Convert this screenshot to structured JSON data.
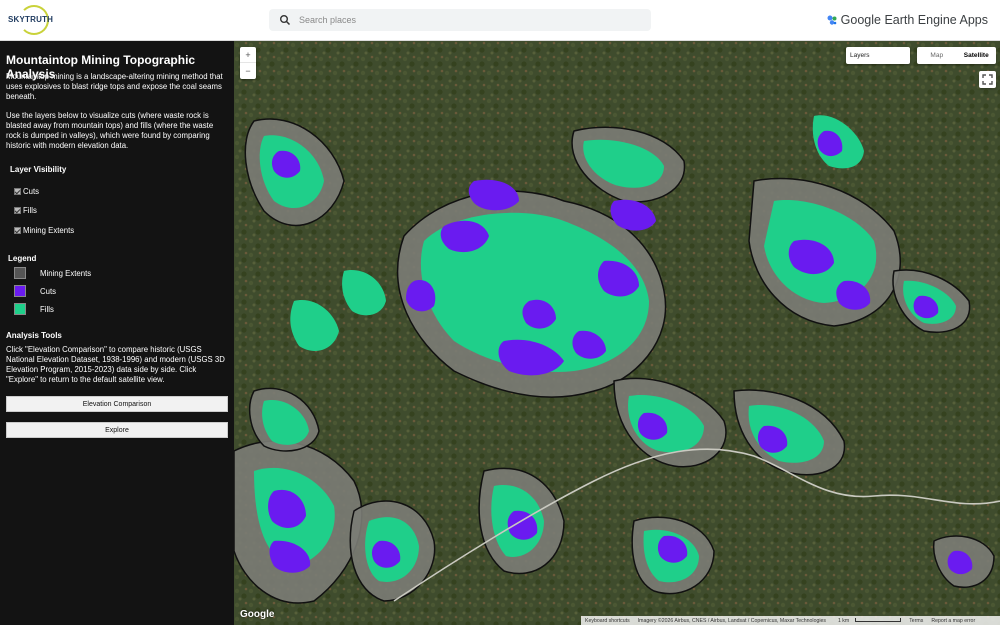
{
  "header": {
    "logo_text": "SKYTRUTH",
    "search_placeholder": "Search places",
    "brand_text": "Google Earth Engine Apps"
  },
  "sidebar": {
    "title": "Mountaintop Mining Topographic Analysis",
    "intro": "Mountaintop mining is a landscape-altering mining method that uses explosives to blast ridge tops and expose the coal seams beneath.",
    "instructions": "Use the layers below to visualize cuts (where waste rock is blasted away from mountain tops) and fills (where the waste rock is dumped in valleys), which were found by comparing historic with modern elevation data.",
    "layer_visibility_heading": "Layer Visibility",
    "layers": [
      {
        "label": "Cuts",
        "checked": true
      },
      {
        "label": "Fills",
        "checked": true
      },
      {
        "label": "Mining Extents",
        "checked": true
      }
    ],
    "legend_heading": "Legend",
    "legend": [
      {
        "label": "Mining Extents",
        "color": "#555555"
      },
      {
        "label": "Cuts",
        "color": "#6a1bf0"
      },
      {
        "label": "Fills",
        "color": "#1fcf8a"
      }
    ],
    "tools_heading": "Analysis Tools",
    "tools_text": "Click \"Elevation Comparison\" to compare historic (USGS National Elevation Dataset, 1938-1996) and modern (USGS 3D Elevation Program, 2015-2023) data side by side. Click \"Explore\" to return to the default satellite view.",
    "buttons": {
      "elevation": "Elevation Comparison",
      "explore": "Explore"
    }
  },
  "map": {
    "zoom_in": "+",
    "zoom_out": "−",
    "layers_select": "Layers",
    "map_type": [
      "Map",
      "Satellite"
    ],
    "active_map_type": "Satellite",
    "google_logo": "Google",
    "attribution": {
      "shortcuts": "Keyboard shortcuts",
      "imagery": "Imagery ©2026 Airbus, CNES / Airbus, Landsat / Copernicus, Maxar Technologies",
      "scale": "1 km",
      "terms": "Terms",
      "report": "Report a map error"
    },
    "colors": {
      "forest": "#3d4a2c",
      "extent": "#7d7d78",
      "cuts": "#6a1bf0",
      "fills": "#1fcf8a"
    }
  }
}
